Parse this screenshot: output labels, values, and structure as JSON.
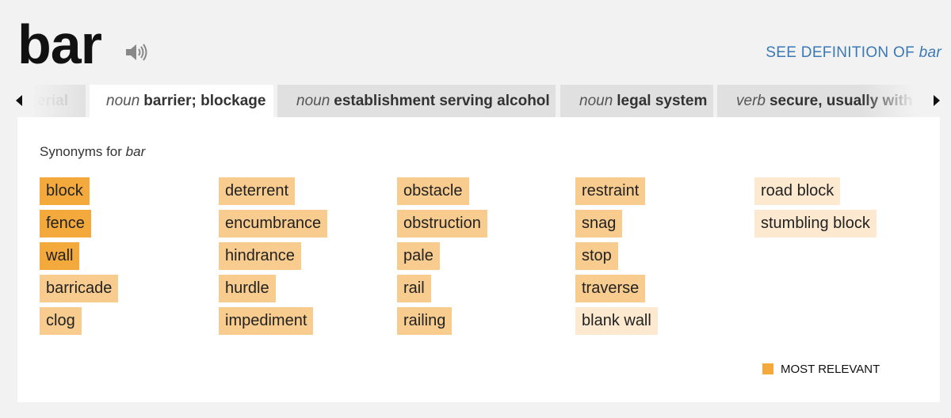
{
  "header": {
    "word": "bar",
    "see_definition_prefix": "SEE DEFINITION OF",
    "see_definition_word": "bar"
  },
  "tabs": [
    {
      "pos": "",
      "sense": "aterial"
    },
    {
      "pos": "noun",
      "sense": "barrier; blockage"
    },
    {
      "pos": "noun",
      "sense": "establishment serving alcohol"
    },
    {
      "pos": "noun",
      "sense": "legal system"
    },
    {
      "pos": "verb",
      "sense": "secure, usually with a lo"
    }
  ],
  "panel": {
    "heading_prefix": "Synonyms for",
    "heading_word": "bar",
    "columns": [
      [
        {
          "word": "block",
          "relevance": 3
        },
        {
          "word": "fence",
          "relevance": 3
        },
        {
          "word": "wall",
          "relevance": 3
        },
        {
          "word": "barricade",
          "relevance": 2
        },
        {
          "word": "clog",
          "relevance": 2
        }
      ],
      [
        {
          "word": "deterrent",
          "relevance": 2
        },
        {
          "word": "encumbrance",
          "relevance": 2
        },
        {
          "word": "hindrance",
          "relevance": 2
        },
        {
          "word": "hurdle",
          "relevance": 2
        },
        {
          "word": "impediment",
          "relevance": 2
        }
      ],
      [
        {
          "word": "obstacle",
          "relevance": 2
        },
        {
          "word": "obstruction",
          "relevance": 2
        },
        {
          "word": "pale",
          "relevance": 2
        },
        {
          "word": "rail",
          "relevance": 2
        },
        {
          "word": "railing",
          "relevance": 2
        }
      ],
      [
        {
          "word": "restraint",
          "relevance": 2
        },
        {
          "word": "snag",
          "relevance": 2
        },
        {
          "word": "stop",
          "relevance": 2
        },
        {
          "word": "traverse",
          "relevance": 2
        },
        {
          "word": "blank wall",
          "relevance": 1
        }
      ],
      [
        {
          "word": "road block",
          "relevance": 1
        },
        {
          "word": "stumbling block",
          "relevance": 1
        }
      ]
    ],
    "legend_label": "MOST RELEVANT"
  },
  "colors": {
    "most_relevant": "#f4a93c",
    "relevant": "#f8cc8e",
    "less_relevant": "#fde9cf",
    "link": "#3a78b7"
  }
}
